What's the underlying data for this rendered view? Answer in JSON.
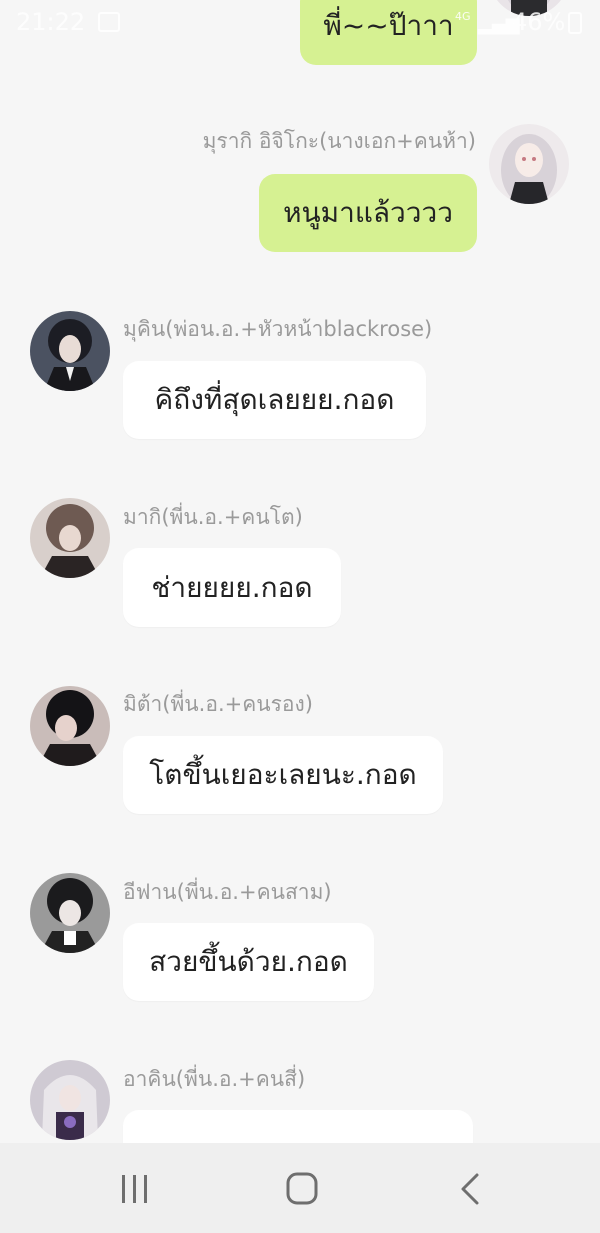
{
  "status_bar": {
    "time": "21:22",
    "network": "4G",
    "battery": "46%"
  },
  "messages": [
    {
      "sender": "",
      "text": "พี่~~ป๊าาา",
      "is_me": true,
      "avatar": "avatar-girl-icon"
    },
    {
      "sender": "มุรากิ อิจิโกะ(นางเอก+คนห้า)",
      "text": "หนูมาแล้วววว",
      "is_me": true,
      "avatar": "avatar-girl-icon"
    },
    {
      "sender": "มุคิน(พ่อน.อ.+หัวหน้าblackrose)",
      "text": "คิถึงที่สุดเลยยย.กอด",
      "is_me": false,
      "avatar": "avatar-man-suit-icon"
    },
    {
      "sender": "มากิ(พี่น.อ.+คนโต)",
      "text": "ช่ายยยย.กอด",
      "is_me": false,
      "avatar": "avatar-brown-hair-icon"
    },
    {
      "sender": "มิต้า(พี่น.อ.+คนรอง)",
      "text": "โตขึ้นเยอะเลยนะ.กอด",
      "is_me": false,
      "avatar": "avatar-dark-hair-icon"
    },
    {
      "sender": "อีฟาน(พี่น.อ.+คนสาม)",
      "text": "สวยขึ้นด้วย.กอด",
      "is_me": false,
      "avatar": "avatar-black-hair-icon"
    },
    {
      "sender": "อาคิน(พี่น.อ.+คนสี่)",
      "text": "",
      "is_me": false,
      "avatar": "avatar-white-hair-icon"
    }
  ],
  "colors": {
    "my_bubble": "#d6f192",
    "other_bubble": "#ffffff",
    "background": "#f6f6f6",
    "sender_name": "#9a9a9a"
  },
  "nav_bar": {
    "recent": "recent-apps-icon",
    "home": "home-icon",
    "back": "back-icon"
  }
}
